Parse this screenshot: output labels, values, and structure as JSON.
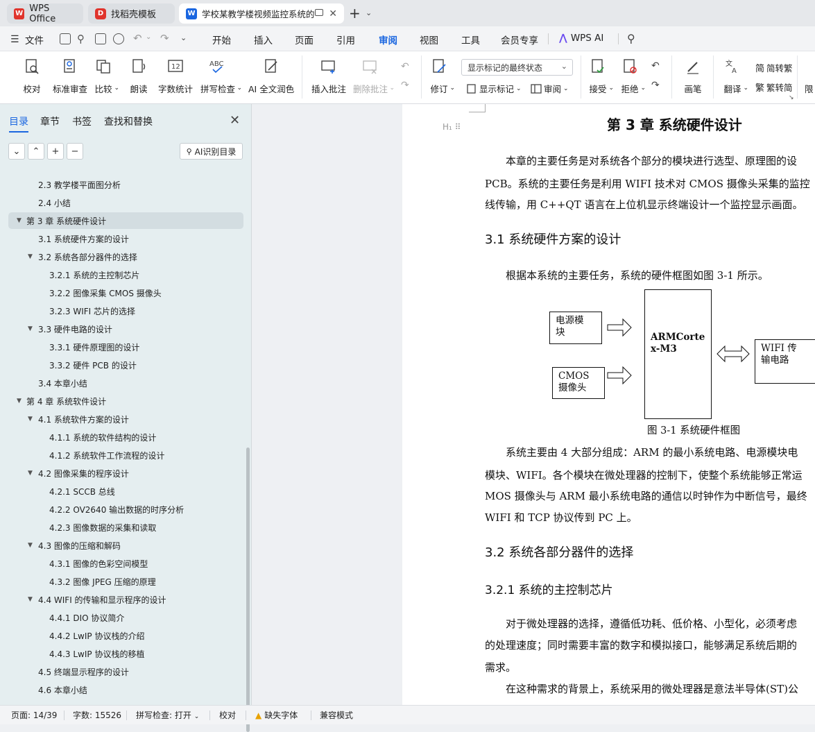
{
  "tabs": [
    {
      "label": "WPS Office",
      "logo": "W"
    },
    {
      "label": "找稻壳模板",
      "logo": "D"
    },
    {
      "label": "学校某教学楼视频监控系统的",
      "logo": "W"
    }
  ],
  "menu": {
    "file_label": "文件",
    "items": [
      "开始",
      "插入",
      "页面",
      "引用",
      "审阅",
      "视图",
      "工具",
      "会员专享"
    ],
    "active": "审阅",
    "wps_ai": "WPS AI"
  },
  "ribbon": {
    "proofread": "校对",
    "std_review": "标准审查",
    "compare": "比较",
    "read_aloud": "朗读",
    "word_count": "字数统计",
    "spell_check": "拼写检查",
    "ai_polish": "AI 全文润色",
    "insert_comment": "插入批注",
    "delete_comment": "删除批注",
    "revise": "修订",
    "show_markup_state": "显示标记的最终状态",
    "show_markup": "显示标记",
    "review": "审阅",
    "accept": "接受",
    "reject": "拒绝",
    "pen": "画笔",
    "translate": "翻译",
    "to_traditional": "简转繁",
    "to_simplified": "繁转简",
    "restrict": "限"
  },
  "sidebar": {
    "tabs": [
      "目录",
      "章节",
      "书签",
      "查找和替换"
    ],
    "active_tab": "目录",
    "ai_toc": "AI识别目录",
    "toc": [
      {
        "label": "2.3  教学楼平面图分析",
        "level": 2,
        "arrow": ""
      },
      {
        "label": "2.4  小结",
        "level": 2,
        "arrow": ""
      },
      {
        "label": "第 3 章  系统硬件设计",
        "level": 1,
        "arrow": "▼",
        "selected": true
      },
      {
        "label": "3.1 系统硬件方案的设计",
        "level": 2,
        "arrow": ""
      },
      {
        "label": "3.2 系统各部分器件的选择",
        "level": 2,
        "arrow": "▼"
      },
      {
        "label": "3.2.1 系统的主控制芯片",
        "level": 3,
        "arrow": ""
      },
      {
        "label": "3.2.2 图像采集 CMOS 摄像头",
        "level": 3,
        "arrow": ""
      },
      {
        "label": "3.2.3 WIFI 芯片的选择",
        "level": 3,
        "arrow": ""
      },
      {
        "label": "3.3 硬件电路的设计",
        "level": 2,
        "arrow": "▼"
      },
      {
        "label": "3.3.1 硬件原理图的设计",
        "level": 3,
        "arrow": ""
      },
      {
        "label": "3.3.2 硬件 PCB 的设计",
        "level": 3,
        "arrow": ""
      },
      {
        "label": "3.4 本章小结",
        "level": 2,
        "arrow": ""
      },
      {
        "label": "第 4 章  系统软件设计",
        "level": 1,
        "arrow": "▼"
      },
      {
        "label": "4.1 系统软件方案的设计",
        "level": 2,
        "arrow": "▼"
      },
      {
        "label": "4.1.1 系统的软件结构的设计",
        "level": 3,
        "arrow": ""
      },
      {
        "label": "4.1.2 系统软件工作流程的设计",
        "level": 3,
        "arrow": ""
      },
      {
        "label": "4.2 图像采集的程序设计",
        "level": 2,
        "arrow": "▼"
      },
      {
        "label": "4.2.1 SCCB 总线",
        "level": 3,
        "arrow": ""
      },
      {
        "label": "4.2.2 OV2640 输出数据的时序分析",
        "level": 3,
        "arrow": ""
      },
      {
        "label": "4.2.3 图像数据的采集和读取",
        "level": 3,
        "arrow": ""
      },
      {
        "label": "4.3 图像的压缩和解码",
        "level": 2,
        "arrow": "▼"
      },
      {
        "label": "4.3.1 图像的色彩空间模型",
        "level": 3,
        "arrow": ""
      },
      {
        "label": "4.3.2 图像 JPEG 压缩的原理",
        "level": 3,
        "arrow": ""
      },
      {
        "label": "4.4 WIFI 的传输和显示程序的设计",
        "level": 2,
        "arrow": "▼"
      },
      {
        "label": "4.4.1 DIO 协议简介",
        "level": 3,
        "arrow": ""
      },
      {
        "label": "4.4.2 LwIP 协议栈的介绍",
        "level": 3,
        "arrow": ""
      },
      {
        "label": "4.4.3 LwIP 协议栈的移植",
        "level": 3,
        "arrow": ""
      },
      {
        "label": "4.5 终端显示程序的设计",
        "level": 2,
        "arrow": ""
      },
      {
        "label": "4.6 本章小结",
        "level": 2,
        "arrow": ""
      }
    ]
  },
  "document": {
    "heading_marker": "H₁",
    "chapter_title": "第 3 章  系统硬件设计",
    "intro": [
      "　　本章的主要任务是对系统各个部分的模块进行选型、原理图的设",
      "PCB。系统的主要任务是利用 WIFI 技术对 CMOS 摄像头采集的监控",
      "线传输，用 C++QT 语言在上位机显示终端设计一个监控显示画面。"
    ],
    "sec31": "3.1 系统硬件方案的设计",
    "sec31_text": "　　根据本系统的主要任务，系统的硬件框图如图 3-1 所示。",
    "diagram": {
      "power": "电源模块",
      "cmos": "CMOS 摄像头",
      "arm": "ARMCortex-M3",
      "wifi": "WIFI 传输电路"
    },
    "caption": "图 3-1 系统硬件框图",
    "summary": [
      "　　系统主要由 4 大部分组成：ARM 的最小系统电路、电源模块电",
      "模块、WIFI。各个模块在微处理器的控制下，使整个系统能够正常运",
      "MOS 摄像头与 ARM 最小系统电路的通信以时钟作为中断信号，最终",
      "WIFI 和 TCP 协议传到 PC 上。"
    ],
    "sec32": "3.2 系统各部分器件的选择",
    "sec321": "3.2.1 系统的主控制芯片",
    "mcu_text": [
      "　　对于微处理器的选择，遵循低功耗、低价格、小型化，必须考虑",
      "的处理速度；同时需要丰富的数字和模拟接口，能够满足系统后期的",
      "需求。",
      "　　在这种需求的背景上，系统采用的微处理器是意法半导体(ST)公"
    ]
  },
  "status": {
    "page": "页面: 14/39",
    "words": "字数: 15526",
    "spell": "拼写检查: 打开",
    "proof": "校对",
    "missing_font": "缺失字体",
    "compat": "兼容模式"
  },
  "colors": {
    "accent": "#1a66e0",
    "wps_red": "#e0342c",
    "sidebar_bg": "#e5eef0"
  }
}
